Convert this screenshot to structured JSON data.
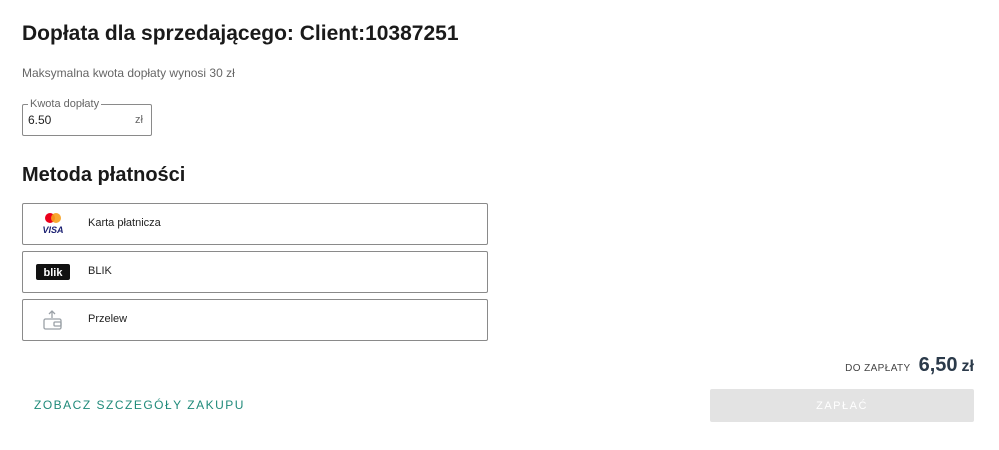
{
  "page": {
    "title": "Dopłata dla sprzedającego: Client:10387251",
    "subtitle": "Maksymalna kwota dopłaty wynosi 30 zł"
  },
  "amount_field": {
    "label": "Kwota dopłaty",
    "value": "6.50",
    "unit": "zł"
  },
  "payment": {
    "section_title": "Metoda płatności",
    "methods": [
      {
        "label": "Karta płatnicza",
        "icon": "mastercard-visa-icon"
      },
      {
        "label": "BLIK",
        "icon": "blik-icon",
        "icon_text": "blik"
      },
      {
        "label": "Przelew",
        "icon": "bank-transfer-icon"
      }
    ]
  },
  "summary": {
    "label": "DO ZAPŁATY",
    "amount": "6,50",
    "currency": "zł"
  },
  "actions": {
    "details_link": "ZOBACZ SZCZEGÓŁY ZAKUPU",
    "pay_button": "ZAPŁAĆ",
    "pay_disabled": true
  },
  "colors": {
    "accent_link": "#1f8a7a",
    "pay_button_disabled_bg": "#e3e3e3",
    "mastercard_red": "#eb001b",
    "mastercard_orange": "#f79e1b",
    "visa_blue": "#1a1f71"
  }
}
